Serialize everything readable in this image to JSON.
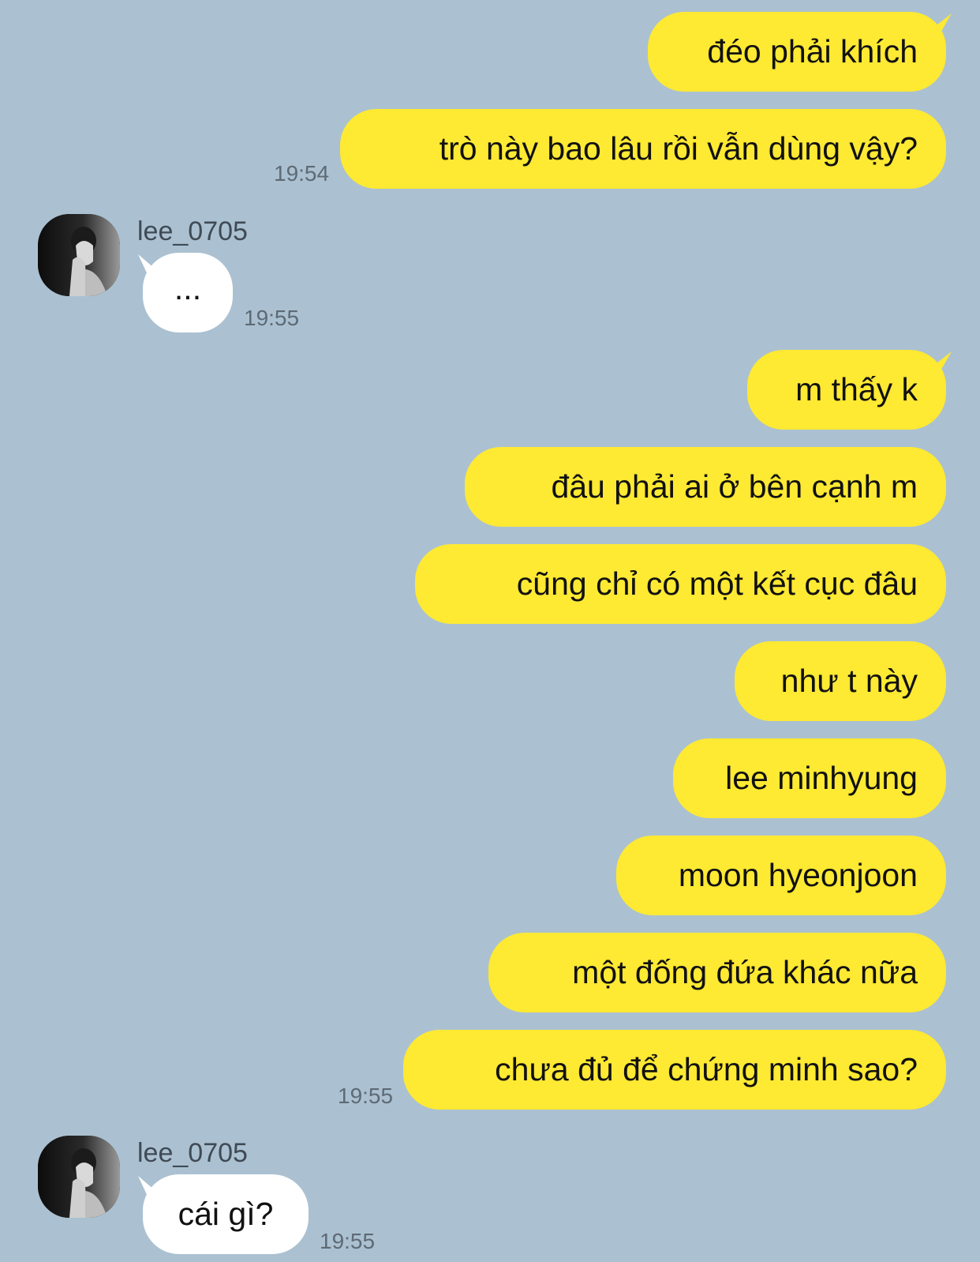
{
  "chat": {
    "background_color": "#abc1d1",
    "sent_bubble_color": "#fee933",
    "received_bubble_color": "#ffffff",
    "messages": [
      {
        "sender": "me",
        "text": "đéo phải khích"
      },
      {
        "sender": "me",
        "text": "trò này bao lâu rồi vẫn dùng vậy?",
        "time": "19:54"
      },
      {
        "sender": "lee_0705",
        "name": "lee_0705",
        "text": "...",
        "time": "19:55",
        "avatar_icon": "profile-photo-avatar"
      },
      {
        "sender": "me",
        "text": "m thấy k"
      },
      {
        "sender": "me",
        "text": "đâu phải ai ở bên cạnh m"
      },
      {
        "sender": "me",
        "text": "cũng chỉ có một kết cục đâu"
      },
      {
        "sender": "me",
        "text": "như t này"
      },
      {
        "sender": "me",
        "text": "lee minhyung"
      },
      {
        "sender": "me",
        "text": "moon hyeonjoon"
      },
      {
        "sender": "me",
        "text": "một đống đứa khác nữa"
      },
      {
        "sender": "me",
        "text": "chưa đủ để chứng minh sao?",
        "time": "19:55"
      },
      {
        "sender": "lee_0705",
        "name": "lee_0705",
        "text": "cái gì?",
        "time": "19:55",
        "avatar_icon": "profile-photo-avatar"
      }
    ]
  }
}
